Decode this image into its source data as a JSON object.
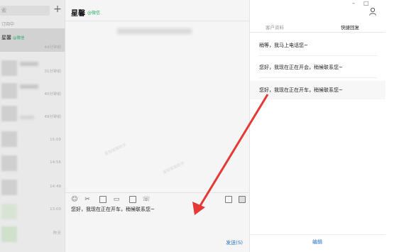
{
  "sidebar": {
    "search_placeholder": "索",
    "status": "订阅中",
    "items": [
      {
        "name": "星馨",
        "wx": "@微信",
        "time": "",
        "active": true
      },
      {
        "time": "44分钟前"
      },
      {
        "time": "31分钟前"
      },
      {
        "time": "40分钟前"
      },
      {
        "time": "49分钟前"
      },
      {
        "time": "15:09"
      },
      {
        "time": "14:56"
      },
      {
        "time": "14:49"
      },
      {
        "time": "13:00"
      },
      {
        "time": "昨天"
      }
    ]
  },
  "chat": {
    "title": "星馨",
    "wx_tag": "@微信",
    "watermark": "星程客服助手",
    "input_text": "您好，我现在正在开车，稍候联系您~",
    "send_label": "发送(S)"
  },
  "right_panel": {
    "tabs": [
      "客户资料",
      "快捷回复"
    ],
    "replies": [
      "稍等，我马上电话您~",
      "您好，我现在正在开会，稍候联系您~",
      "您好，我现在正在开车，稍候联系您~"
    ],
    "edit_label": "编辑"
  },
  "colors": {
    "accent_link": "#2a73c4",
    "wechat_green": "#2aae67",
    "arrow": "#e53935"
  },
  "icons": [
    "plus-icon",
    "emoji-icon",
    "scissors-icon",
    "image-icon",
    "folder-icon",
    "card-icon",
    "phone-icon",
    "screenshot-icon",
    "chat-history-icon",
    "user-icon",
    "minimize-icon",
    "maximize-icon"
  ]
}
